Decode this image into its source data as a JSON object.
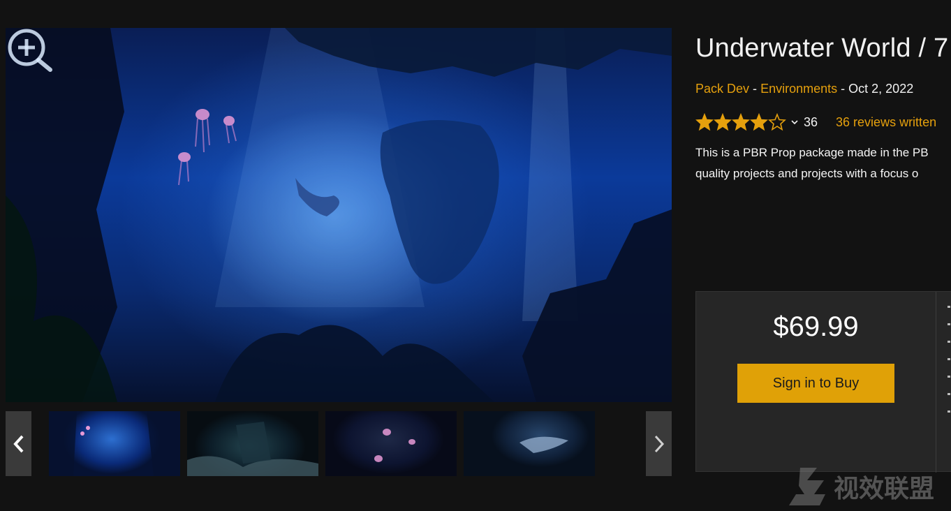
{
  "product": {
    "title": "Underwater World / 7",
    "publisher": "Pack Dev",
    "separator": "-",
    "category": "Environments",
    "date": "Oct 2, 2022",
    "rating_stars": 4,
    "rating_max": 5,
    "rating_count": "36",
    "reviews_link": "36 reviews written",
    "description_line1": "This is a PBR Prop package made in the PB",
    "description_line2": "quality projects and projects with a focus o"
  },
  "purchase": {
    "price": "$69.99",
    "buy_label": "Sign in to Buy"
  },
  "gallery": {
    "thumbnail_count": 4
  },
  "watermark": {
    "text": "视效联盟"
  },
  "colors": {
    "accent": "#e5a00d",
    "button": "#e0a107",
    "background": "#121212",
    "panel": "#262626"
  }
}
